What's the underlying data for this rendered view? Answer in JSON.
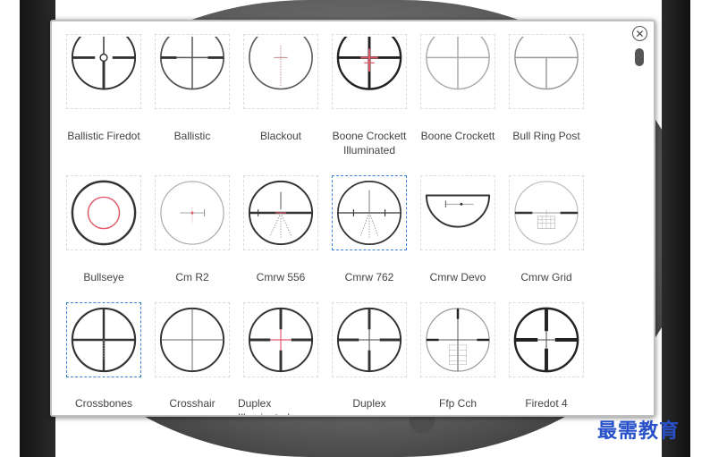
{
  "dialog": {
    "close_glyph": "✕",
    "rows": [
      [
        {
          "label": "Ballistic Firedot",
          "selected": false
        },
        {
          "label": "Ballistic",
          "selected": false
        },
        {
          "label": "Blackout",
          "selected": false
        },
        {
          "label": "Boone Crockett",
          "label2": "Illuminated",
          "selected": false
        },
        {
          "label": "Boone Crockett",
          "selected": false
        },
        {
          "label": "Bull Ring Post",
          "selected": false
        }
      ],
      [
        {
          "label": "Bullseye",
          "selected": false
        },
        {
          "label": "Cm R2",
          "selected": false
        },
        {
          "label": "Cmrw 556",
          "selected": false
        },
        {
          "label": "Cmrw 762",
          "selected": true
        },
        {
          "label": "Cmrw Devo",
          "selected": false
        },
        {
          "label": "Cmrw Grid",
          "selected": false
        }
      ],
      [
        {
          "label": "Crossbones",
          "selected": true
        },
        {
          "label": "Crosshair",
          "selected": false
        },
        {
          "label": "Duplex",
          "label2": "Illuminated",
          "selected": false
        },
        {
          "label": "Duplex",
          "selected": false
        },
        {
          "label": "Ffp Cch",
          "selected": false
        },
        {
          "label": "Firedot 4",
          "selected": false
        }
      ]
    ]
  },
  "watermark": "最需教育",
  "colors": {
    "selected_border": "#3b7fd6",
    "reticle_red": "#e05a6a"
  }
}
